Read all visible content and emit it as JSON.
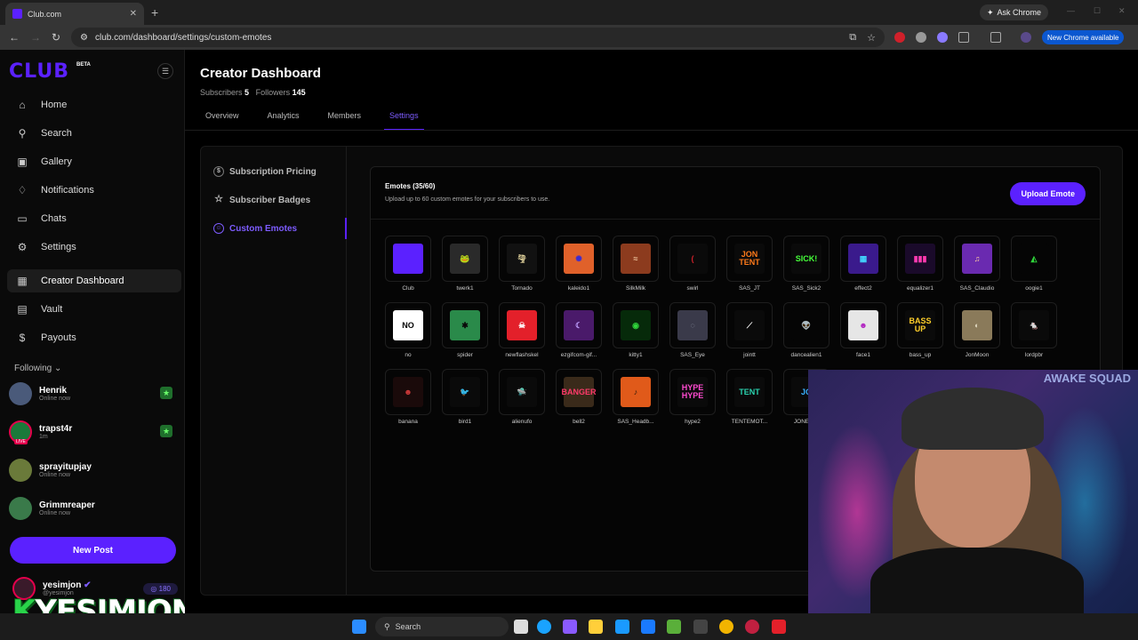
{
  "browser": {
    "tab_title": "Club.com",
    "url": "club.com/dashboard/settings/custom-emotes",
    "ask_chrome": "Ask Chrome",
    "new_chrome": "New Chrome available"
  },
  "sidebar": {
    "logo": "CLUB",
    "beta": "BETA",
    "nav": [
      {
        "label": "Home",
        "icon": "home-icon"
      },
      {
        "label": "Search",
        "icon": "search-icon"
      },
      {
        "label": "Gallery",
        "icon": "gallery-icon"
      },
      {
        "label": "Notifications",
        "icon": "bell-icon"
      },
      {
        "label": "Chats",
        "icon": "chat-icon"
      },
      {
        "label": "Settings",
        "icon": "gear-icon"
      },
      {
        "label": "Creator Dashboard",
        "icon": "dashboard-icon"
      },
      {
        "label": "Vault",
        "icon": "vault-icon"
      },
      {
        "label": "Payouts",
        "icon": "dollar-icon"
      }
    ],
    "following_label": "Following",
    "following": [
      {
        "name": "Henrik",
        "status": "Online now"
      },
      {
        "name": "trapst4r",
        "status": "1m"
      },
      {
        "name": "sprayitupjay",
        "status": "Online now"
      },
      {
        "name": "Grimmreaper",
        "status": "Online now"
      }
    ],
    "new_post": "New Post",
    "me": {
      "name": "yesimjon",
      "handle": "@yesimjon",
      "credits": "180"
    },
    "watermark": "YESIMJON"
  },
  "main": {
    "title": "Creator Dashboard",
    "subscribers_label": "Subscribers",
    "subscribers": "5",
    "followers_label": "Followers",
    "followers": "145",
    "tabs": [
      "Overview",
      "Analytics",
      "Members",
      "Settings"
    ],
    "settings_nav": [
      "Subscription Pricing",
      "Subscriber Badges",
      "Custom Emotes"
    ],
    "emotes_title": "Emotes (35/60)",
    "emotes_sub": "Upload up to 60 custom emotes for your subscribers to use.",
    "upload_label": "Upload Emote",
    "emotes": [
      {
        "name": "Club",
        "bg": "#5b21ff",
        "fg": "#ffffff",
        "txt": ""
      },
      {
        "name": "twerk1",
        "bg": "#2a2a2a",
        "fg": "#d8e04a",
        "txt": "🐸"
      },
      {
        "name": "Tornado",
        "bg": "#111111",
        "fg": "#e8d9a0",
        "txt": "🌪"
      },
      {
        "name": "kaleido1",
        "bg": "#e0612a",
        "fg": "#3b2bd1",
        "txt": "✺"
      },
      {
        "name": "SilkMilk",
        "bg": "#8c3b1e",
        "fg": "#f0c8a0",
        "txt": "≈"
      },
      {
        "name": "swirl",
        "bg": "#0a0a0a",
        "fg": "#d0202a",
        "txt": "("
      },
      {
        "name": "SAS_JT",
        "bg": "#0a0a0a",
        "fg": "#ff7a1a",
        "txt": "JON TENT"
      },
      {
        "name": "SAS_Sick2",
        "bg": "#0a0a0a",
        "fg": "#46ff3a",
        "txt": "SICK!"
      },
      {
        "name": "effect2",
        "bg": "#3a1a8c",
        "fg": "#42d6ff",
        "txt": "▦"
      },
      {
        "name": "equalizer1",
        "bg": "#1a0a2a",
        "fg": "#ff3ab0",
        "txt": "▮▮▮"
      },
      {
        "name": "SAS_Claudio",
        "bg": "#6a2ab0",
        "fg": "#ffd0a0",
        "txt": "♫"
      },
      {
        "name": "oogie1",
        "bg": "#050505",
        "fg": "#2fd43a",
        "txt": "◭"
      },
      {
        "name": "no",
        "bg": "#ffffff",
        "fg": "#000000",
        "txt": "NO"
      },
      {
        "name": "spider",
        "bg": "#2a8a4a",
        "fg": "#0a0a0a",
        "txt": "✱"
      },
      {
        "name": "newflashskel",
        "bg": "#e3202a",
        "fg": "#ffffff",
        "txt": "☠"
      },
      {
        "name": "ezgifcom-gif...",
        "bg": "#4a1a6a",
        "fg": "#c0a0ff",
        "txt": "☾"
      },
      {
        "name": "kitty1",
        "bg": "#062a0a",
        "fg": "#2fd43a",
        "txt": "◉"
      },
      {
        "name": "SAS_Eye",
        "bg": "#3a3a4a",
        "fg": "#9aa0b0",
        "txt": "◌"
      },
      {
        "name": "jointt",
        "bg": "#0a0a0a",
        "fg": "#ffffff",
        "txt": "⟋"
      },
      {
        "name": "dancealien1",
        "bg": "#050505",
        "fg": "#2fd43a",
        "txt": "👽"
      },
      {
        "name": "face1",
        "bg": "#e6e6e6",
        "fg": "#b020c0",
        "txt": "☻"
      },
      {
        "name": "bass_up",
        "bg": "#0a0a0a",
        "fg": "#ffcf2a",
        "txt": "BASS UP"
      },
      {
        "name": "JonMoon",
        "bg": "#8a7a5a",
        "fg": "#e0d8c0",
        "txt": "◐"
      },
      {
        "name": "lordpbr",
        "bg": "#0a0a0a",
        "fg": "#ffffff",
        "txt": "🐁"
      },
      {
        "name": "banana",
        "bg": "#1a0a0a",
        "fg": "#d03a3a",
        "txt": "☻"
      },
      {
        "name": "bird1",
        "bg": "#0a0a0a",
        "fg": "#d8e04a",
        "txt": "🐦"
      },
      {
        "name": "alienufo",
        "bg": "#0a0a0a",
        "fg": "#dddddd",
        "txt": "🛸"
      },
      {
        "name": "bell2",
        "bg": "#3a2a1a",
        "fg": "#ff3a6a",
        "txt": "BANGER"
      },
      {
        "name": "SAS_Headb...",
        "bg": "#e05a1a",
        "fg": "#2a1a0a",
        "txt": "♪"
      },
      {
        "name": "hype2",
        "bg": "#0a0a0a",
        "fg": "#ff4ad0",
        "txt": "HYPE HYPE"
      },
      {
        "name": "TENTEMOT...",
        "bg": "#0a0a0a",
        "fg": "#2ad4b0",
        "txt": "TENT"
      },
      {
        "name": "JONEM...",
        "bg": "#0a0a0a",
        "fg": "#3ab0ff",
        "txt": "JO"
      }
    ]
  },
  "taskbar": {
    "search": "Search"
  }
}
